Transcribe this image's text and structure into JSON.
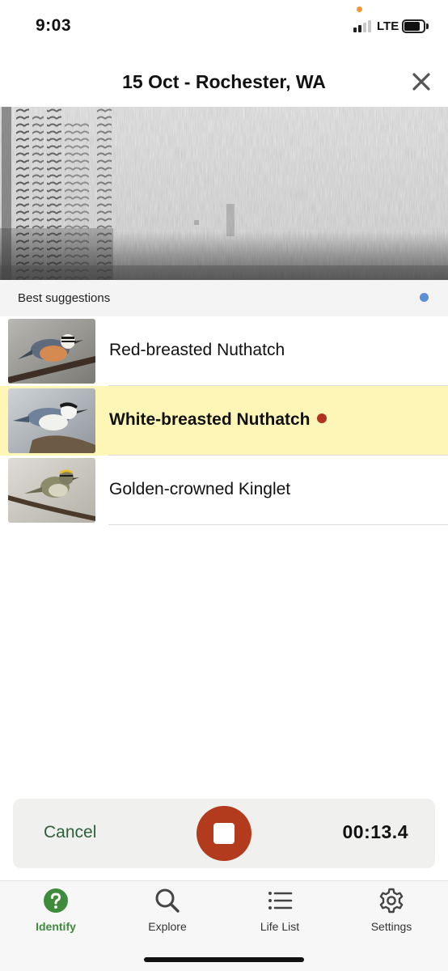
{
  "status_bar": {
    "time": "9:03",
    "network": "LTE",
    "icons": [
      "signal-icon",
      "battery-icon"
    ]
  },
  "header": {
    "title": "15 Oct - Rochester, WA",
    "close_icon": "close-icon"
  },
  "suggestions": {
    "title": "Best suggestions",
    "items": [
      {
        "name": "Red-breasted Nuthatch",
        "image": "red-breasted-nuthatch-photo",
        "highlighted": false
      },
      {
        "name": "White-breasted Nuthatch",
        "image": "white-breasted-nuthatch-photo",
        "highlighted": true
      },
      {
        "name": "Golden-crowned Kinglet",
        "image": "golden-crowned-kinglet-photo",
        "highlighted": false
      }
    ]
  },
  "recording": {
    "cancel_label": "Cancel",
    "timer": "00:13.4",
    "stop_icon": "stop-icon"
  },
  "tabs": [
    {
      "label": "Identify",
      "icon": "help-circle-icon",
      "active": true
    },
    {
      "label": "Explore",
      "icon": "search-icon",
      "active": false
    },
    {
      "label": "Life List",
      "icon": "list-icon",
      "active": false
    },
    {
      "label": "Settings",
      "icon": "gear-icon",
      "active": false
    }
  ],
  "colors": {
    "accent_green": "#3f8a3b",
    "record_red": "#b23b1d",
    "highlight_yellow": "#fdf6b7",
    "indicator_blue": "#5b8fd6"
  }
}
